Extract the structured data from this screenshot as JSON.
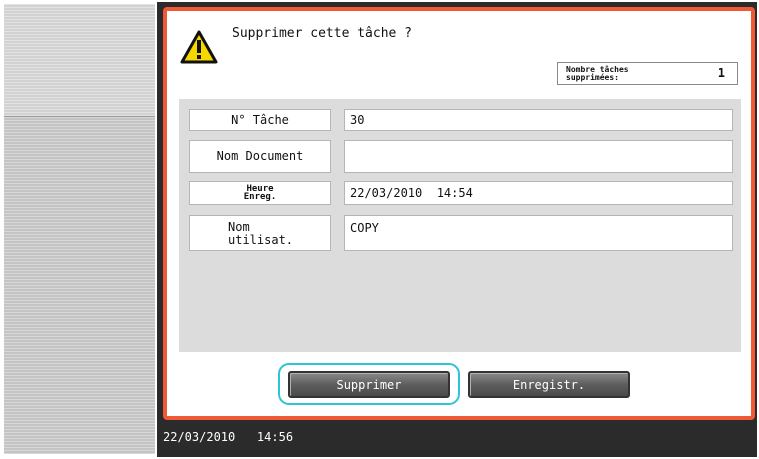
{
  "dialog": {
    "question": "Supprimer cette tâche ?",
    "deleted_count_label": "Nombre tâches supprimées:",
    "deleted_count_value": "1"
  },
  "job_info": {
    "job_number": {
      "label": "N° Tâche",
      "value": "30"
    },
    "document_name": {
      "label": "Nom Document",
      "value": ""
    },
    "registration_time": {
      "label": "Heure Enreg.",
      "value": "22/03/2010  14:54"
    },
    "user_name": {
      "label_line1": "Nom",
      "label_line2": "utilisat.",
      "value": "COPY"
    }
  },
  "buttons": {
    "delete": "Supprimer",
    "register": "Enregistr."
  },
  "footer": {
    "datetime": "22/03/2010   14:56"
  },
  "colors": {
    "dialog_border": "#ef5a36",
    "highlight": "#2ec4d6",
    "screen_background": "#2b2b2b"
  },
  "icons": {
    "warning": "warning-triangle-icon"
  }
}
